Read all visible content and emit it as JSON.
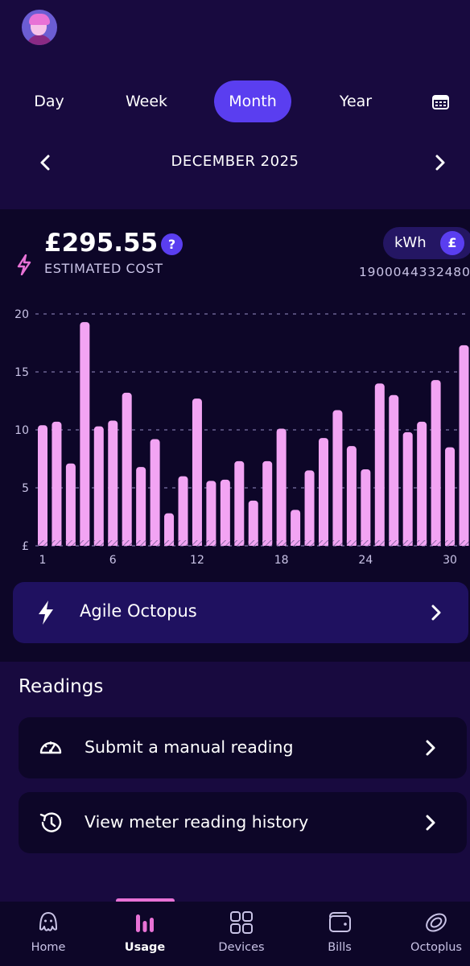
{
  "header": {
    "avatar_alt": ""
  },
  "period_tabs": [
    {
      "label": "Day",
      "active": false
    },
    {
      "label": "Week",
      "active": false
    },
    {
      "label": "Month",
      "active": true
    },
    {
      "label": "Year",
      "active": false
    }
  ],
  "month": {
    "label": "DECEMBER 2025"
  },
  "cost": {
    "value": "£295.55",
    "help": "?",
    "caption": "ESTIMATED COST"
  },
  "unit_toggle": {
    "kwh": "kWh",
    "gbp": "£",
    "selected": "£"
  },
  "meter_id": "1900044332480",
  "chart_data": {
    "type": "bar",
    "x": [
      1,
      2,
      3,
      4,
      5,
      6,
      7,
      8,
      9,
      10,
      11,
      12,
      13,
      14,
      15,
      16,
      17,
      18,
      19,
      20,
      21,
      22,
      23,
      24,
      25,
      26,
      27,
      28,
      29,
      30,
      31
    ],
    "values": [
      10.4,
      10.7,
      7.1,
      19.3,
      10.3,
      10.8,
      13.2,
      6.8,
      9.2,
      2.8,
      6.0,
      12.7,
      5.6,
      5.7,
      7.3,
      3.9,
      7.3,
      10.1,
      3.1,
      6.5,
      9.3,
      11.7,
      8.6,
      6.6,
      14.0,
      13.0,
      9.8,
      10.7,
      14.3,
      8.5,
      17.3
    ],
    "xticks": [
      "1",
      "6",
      "12",
      "18",
      "24",
      "30"
    ],
    "yticks": [
      "£",
      "5",
      "10",
      "15",
      "20"
    ],
    "ylim": [
      0,
      20
    ],
    "grid": true,
    "bar_color": "#f2a4f3"
  },
  "tariff": {
    "label": "Agile Octopus"
  },
  "readings": {
    "title": "Readings",
    "items": [
      {
        "label": "Submit a manual reading"
      },
      {
        "label": "View meter reading history"
      }
    ]
  },
  "nav": [
    {
      "label": "Home",
      "active": false
    },
    {
      "label": "Usage",
      "active": true
    },
    {
      "label": "Devices",
      "active": false
    },
    {
      "label": "Bills",
      "active": false
    },
    {
      "label": "Octoplus",
      "active": false
    }
  ],
  "colors": {
    "background": "#180a3f",
    "card": "#0d0628",
    "accent": "#5a3ef0",
    "bar": "#f2a4f3",
    "nav_indicator": "#e872d6"
  }
}
